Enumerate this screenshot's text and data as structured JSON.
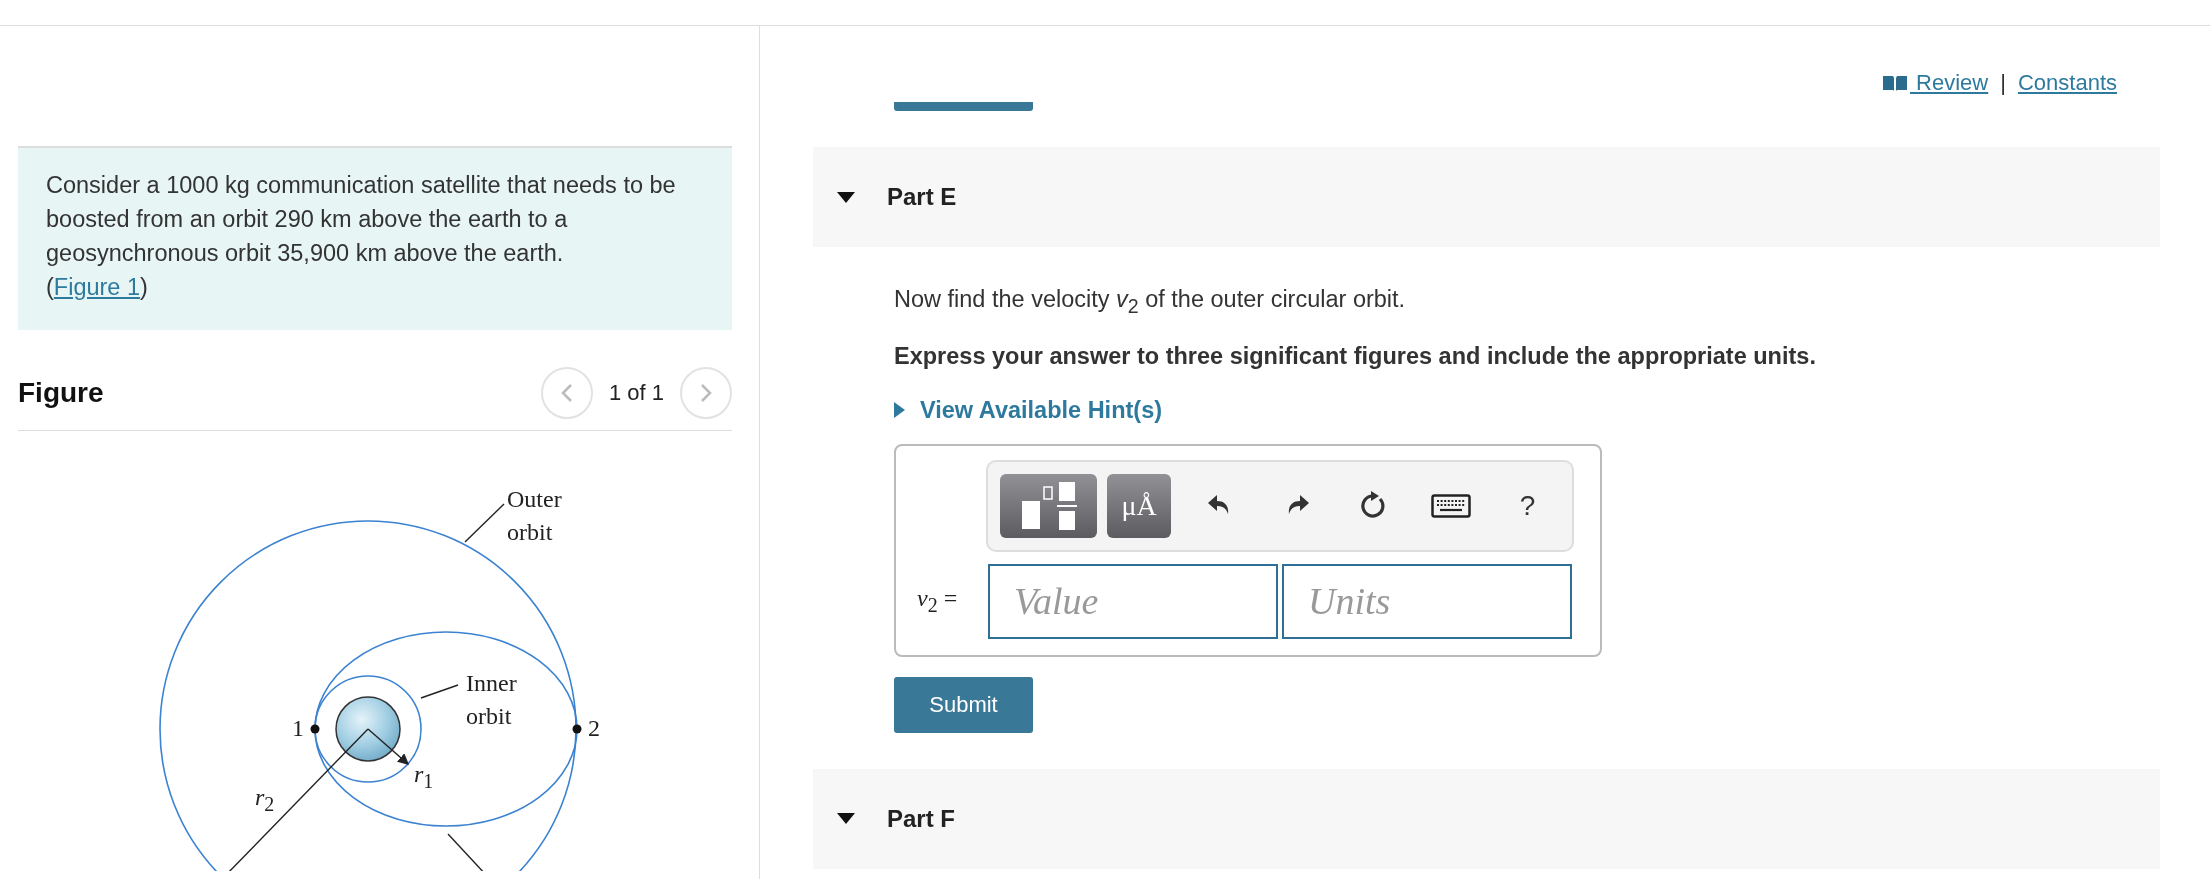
{
  "header_links": {
    "items": [
      {
        "label": " Review",
        "kind": "review"
      },
      {
        "label": "Constants",
        "kind": "plain"
      }
    ],
    "separator": "|"
  },
  "problem": {
    "text": "Consider a 1000 kg communication satellite that needs to be boosted from an orbit 290 km above the earth to a geosynchronous orbit 35,900 km above the earth.",
    "link_before": "(",
    "figure_link": "Figure 1",
    "link_after": ")"
  },
  "figure": {
    "title": "Figure",
    "page": "1 of 1",
    "prev": {
      "disabled": true
    },
    "next": {
      "disabled": true
    },
    "diagram": {
      "outer_label": "Outer orbit",
      "inner_label": "Inner orbit",
      "point_labels": [
        "1",
        "2"
      ],
      "radius_labels": [
        "*r*$_{1}$",
        "*r*$_{2}$"
      ]
    }
  },
  "parts": [
    {
      "title": "Part E",
      "expanded": true,
      "question": "Now find the velocity *v*$_{2}$ of the outer circular orbit.",
      "instruction": "Express your answer to three significant figures and include the appropriate units.",
      "hint": {
        "label": "View Available Hint(s)",
        "expanded": false
      },
      "answer": {
        "variable": "*v*$_{2}$ =",
        "units_button": "μÅ",
        "help": "?",
        "value_placeholder": "Value",
        "units_placeholder": "Units"
      },
      "submit": "Submit"
    },
    {
      "title": "Part F",
      "expanded": true
    }
  ]
}
